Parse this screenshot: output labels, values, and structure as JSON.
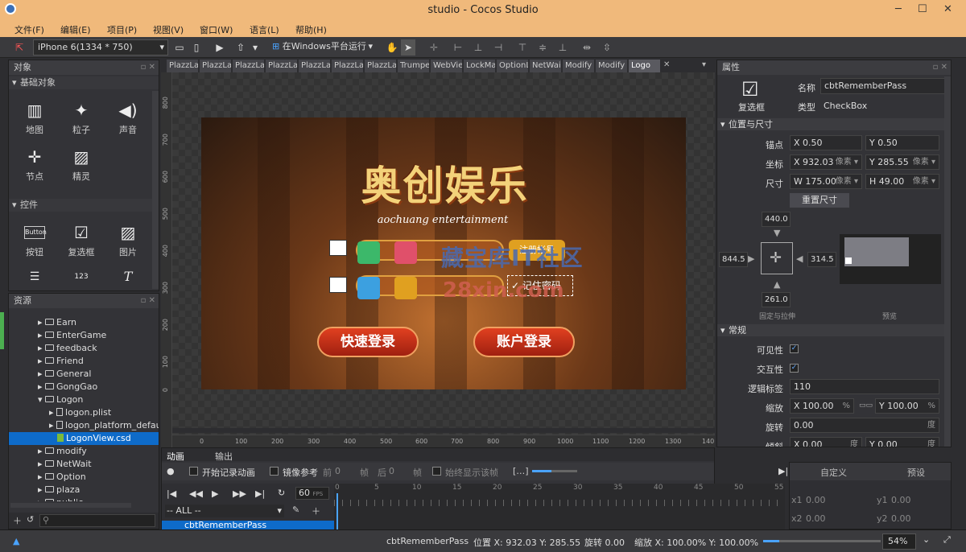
{
  "window": {
    "title": "studio - Cocos Studio",
    "minimize": "─",
    "maximize": "☐",
    "close": "✕"
  },
  "menu": [
    "文件(F)",
    "编辑(E)",
    "项目(P)",
    "视图(V)",
    "窗口(W)",
    "语言(L)",
    "帮助(H)"
  ],
  "toolbar": {
    "device": "iPhone 6(1334 * 750)",
    "run_target": "在Windows平台运行"
  },
  "objects_panel": {
    "title": "对象",
    "basic_section": "基础对象",
    "basic_items": [
      {
        "label": "地图",
        "icon": "map-icon",
        "glyph": "▥"
      },
      {
        "label": "粒子",
        "icon": "particle-icon",
        "glyph": "✦"
      },
      {
        "label": "声音",
        "icon": "sound-icon",
        "glyph": "◀)"
      },
      {
        "label": "节点",
        "icon": "node-icon",
        "glyph": "✛"
      },
      {
        "label": "精灵",
        "icon": "sprite-icon",
        "glyph": "▨"
      }
    ],
    "controls_section": "控件",
    "control_items": [
      {
        "label": "按钮",
        "icon": "button-icon",
        "glyph": "Button"
      },
      {
        "label": "复选框",
        "icon": "checkbox-icon",
        "glyph": "☑"
      },
      {
        "label": "图片",
        "icon": "image-icon",
        "glyph": "▨"
      },
      {
        "label": "",
        "icon": "text-area-icon",
        "glyph": "☰"
      },
      {
        "label": "",
        "icon": "number-label-icon",
        "glyph": "123"
      },
      {
        "label": "",
        "icon": "text-icon",
        "glyph": "T"
      }
    ]
  },
  "resources_panel": {
    "title": "资源",
    "items": [
      {
        "label": "Earn",
        "type": "folder",
        "indent": 1
      },
      {
        "label": "EnterGame",
        "type": "folder",
        "indent": 1
      },
      {
        "label": "feedback",
        "type": "folder",
        "indent": 1
      },
      {
        "label": "Friend",
        "type": "folder",
        "indent": 1
      },
      {
        "label": "General",
        "type": "folder",
        "indent": 1
      },
      {
        "label": "GongGao",
        "type": "folder",
        "indent": 1
      },
      {
        "label": "Logon",
        "type": "folder-open",
        "indent": 1
      },
      {
        "label": "logon.plist",
        "type": "file",
        "indent": 2
      },
      {
        "label": "logon_platform_defau",
        "type": "file",
        "indent": 2
      },
      {
        "label": "LogonView.csd",
        "type": "csd",
        "indent": 2,
        "selected": true
      },
      {
        "label": "modify",
        "type": "folder",
        "indent": 1
      },
      {
        "label": "NetWait",
        "type": "folder",
        "indent": 1
      },
      {
        "label": "Option",
        "type": "folder",
        "indent": 1
      },
      {
        "label": "plaza",
        "type": "folder",
        "indent": 1
      },
      {
        "label": "public",
        "type": "folder",
        "indent": 1
      }
    ]
  },
  "tabs": [
    "PlazzLa",
    "PlazzLa",
    "PlazzLa",
    "PlazzLa",
    "PlazzLa",
    "PlazzLa",
    "PlazzLa",
    "Trumpe",
    "WebVie",
    "LockMa",
    "OptionL",
    "NetWai",
    "Modify",
    "Modify",
    "Logo"
  ],
  "ruler": {
    "h_ticks": [
      "0",
      "100",
      "200",
      "300",
      "400",
      "500",
      "600",
      "700",
      "800",
      "900",
      "1000",
      "1100",
      "1200",
      "1300",
      "140"
    ],
    "v_ticks": [
      "800",
      "700",
      "600",
      "500",
      "400",
      "300",
      "200",
      "100",
      "0"
    ]
  },
  "scene": {
    "logo": "奥创娱乐",
    "logo_sub": "aochuang entertainment",
    "register_btn": "注册帐号",
    "remember_pass": "记住密码",
    "quick_login": "快速登录",
    "account_login": "账户登录",
    "watermark1": "藏宝库IT社区",
    "watermark2": "28xin.com"
  },
  "animation_panel": {
    "tab_anim": "动画",
    "tab_output": "输出",
    "record": "开始记录动画",
    "mirror": "镜像参考",
    "prev_label": "前",
    "prev_val": "0",
    "frame1": "帧",
    "next_label": "后",
    "next_val": "0",
    "frame2": "帧",
    "always_show": "始终显示该帧",
    "fps": "60",
    "fps_unit": "FPS",
    "all_dropdown": "-- ALL --",
    "track": "cbtRememberPass",
    "timeline_ticks": [
      "0",
      "5",
      "10",
      "15",
      "20",
      "25",
      "30",
      "35",
      "40",
      "45",
      "50",
      "55"
    ],
    "custom": "自定义",
    "preset": "预设",
    "x1": "x1",
    "x1v": "0.00",
    "y1": "y1",
    "y1v": "0.00",
    "x2": "x2",
    "x2v": "0.00",
    "y2": "y2",
    "y2v": "0.00"
  },
  "properties": {
    "title": "属性",
    "widget_type_label": "复选框",
    "name_label": "名称",
    "name_value": "cbtRememberPass",
    "type_label": "类型",
    "type_value": "CheckBox",
    "pos_section": "位置与尺寸",
    "anchor_label": "锚点",
    "anchor_x": "0.50",
    "anchor_y": "0.50",
    "coord_label": "坐标",
    "coord_x": "932.03",
    "coord_y": "285.55",
    "unit_px": "像素",
    "size_label": "尺寸",
    "size_w": "175.00",
    "size_h": "49.00",
    "reset_size": "重置尺寸",
    "margin_top": "440.0",
    "margin_left": "844.5",
    "margin_right": "314.5",
    "margin_bottom": "261.0",
    "fixed_stretch": "固定与拉伸",
    "preview": "预览",
    "general_section": "常规",
    "visible_label": "可见性",
    "interactive_label": "交互性",
    "tag_label": "逻辑标签",
    "tag_value": "110",
    "scale_label": "缩放",
    "scale_x": "100.00",
    "scale_y": "100.00",
    "pct": "%",
    "rotate_label": "旋转",
    "rotate_value": "0.00",
    "deg": "度",
    "skew_label": "倾斜",
    "skew_x": "0.00",
    "skew_y": "0.00",
    "X": "X",
    "Y": "Y",
    "W": "W",
    "H": "H"
  },
  "status": {
    "name": "cbtRememberPass",
    "pos": "位置 X: 932.03   Y: 285.55",
    "rot": "旋转 0.00",
    "scale": "缩放 X: 100.00%   Y: 100.00%",
    "zoom": "54%"
  }
}
